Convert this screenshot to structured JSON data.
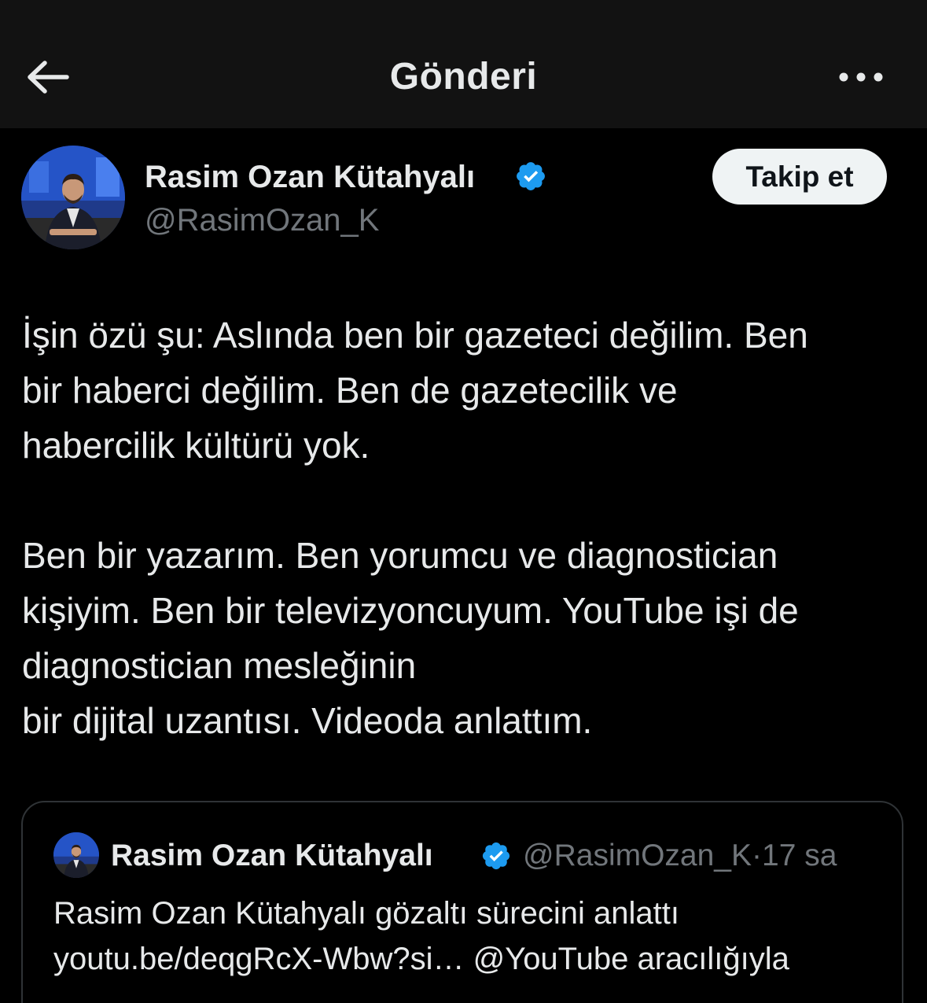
{
  "header": {
    "title": "Gönderi",
    "back_icon": "arrow-left-icon",
    "more_icon": "more-horizontal-icon"
  },
  "post": {
    "author_name": "Rasim Ozan Kütahyalı",
    "author_handle": "@RasimOzan_K",
    "verified": true,
    "follow_label": "Takip et",
    "text_lines": [
      "İşin özü şu: Aslında ben bir gazeteci değilim. Ben",
      "bir haberci değilim. Ben de gazetecilik ve",
      "habercilik kültürü yok.",
      "",
      "Ben bir yazarım. Ben yorumcu ve diagnostician",
      "kişiyim. Ben bir televizyoncuyum. YouTube işi de",
      "diagnostician mesleğinin",
      "bir dijital uzantısı. Videoda anlattım."
    ]
  },
  "quote": {
    "author_name": "Rasim Ozan Kütahyalı",
    "author_handle": "@RasimOzan_K",
    "separator": "·",
    "time": "17 sa",
    "text_lines": [
      "Rasim Ozan Kütahyalı gözaltı sürecini anlattı",
      "youtu.be/deqgRcX-Wbw?si… @YouTube aracılığıyla"
    ]
  },
  "colors": {
    "background": "#000000",
    "header_bg": "#121212",
    "text_primary": "#e7e9ea",
    "text_secondary": "#71767b",
    "verified_blue": "#1d9bf0",
    "follow_bg": "#eff3f4",
    "border": "#2f3336"
  }
}
